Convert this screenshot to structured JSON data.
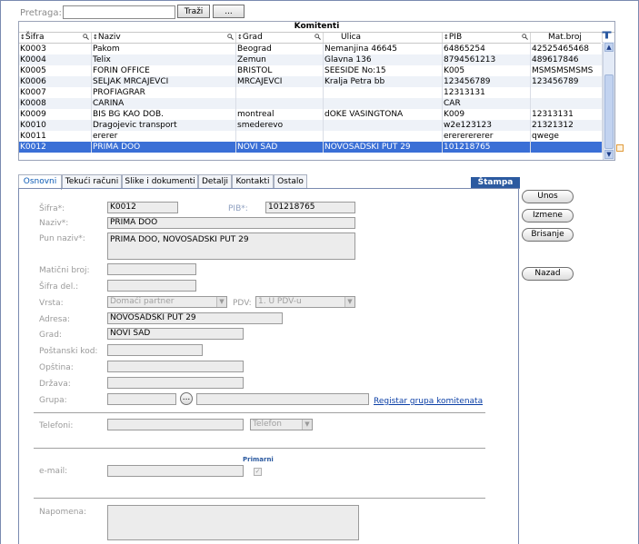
{
  "search": {
    "label": "Pretraga:",
    "value": "",
    "search_button": "Traži",
    "more_button": "..."
  },
  "grid": {
    "title": "Komitenti",
    "columns": [
      "Šifra",
      "Naziv",
      "Grad",
      "Ulica",
      "PIB",
      "Mat.broj"
    ],
    "rows": [
      [
        "K0003",
        "Pakom",
        "Beograd",
        "Nemanjina 46645",
        "64865254",
        "42525465468"
      ],
      [
        "K0004",
        "Telix",
        "Zemun",
        "Glavna 136",
        "8794561213",
        "489617846"
      ],
      [
        "K0005",
        "FORIN OFFICE",
        "BRISTOL",
        "SEESIDE No:15",
        "K005",
        "MSMSMSMSMS"
      ],
      [
        "K0006",
        "SELJAK MRCAJEVCI",
        "MRCAJEVCI",
        "Kralja Petra bb",
        "123456789",
        "123456789"
      ],
      [
        "K0007",
        "PROFIAGRAR",
        "",
        "",
        "12313131",
        ""
      ],
      [
        "K0008",
        "CARINA",
        "",
        "",
        "CAR",
        ""
      ],
      [
        "K0009",
        "BIS BG KAO DOB.",
        "montreal",
        "dOKE VASINGTONA",
        "K009",
        "12313131"
      ],
      [
        "K0010",
        "Dragojevic transport",
        "smederevo",
        "",
        "w2e123123",
        "21321312"
      ],
      [
        "K0011",
        "ererer",
        "",
        "",
        "erererererer",
        "qwege"
      ],
      [
        "K0012",
        "PRIMA DOO",
        "NOVI SAD",
        "NOVOSADSKI PUT 29",
        "101218765",
        ""
      ]
    ],
    "selected_row": 9
  },
  "tabs": [
    "Osnovni",
    "Tekući računi",
    "Slike i dokumenti",
    "Detalji",
    "Kontakti",
    "Ostalo"
  ],
  "stampa": "Štampa",
  "form": {
    "sifra_label": "Šifra*:",
    "sifra_value": "K0012",
    "pib_label": "PIB*:",
    "pib_value": "101218765",
    "naziv_label": "Naziv*:",
    "naziv_value": "PRIMA DOO",
    "pun_naziv_label": "Pun naziv*:",
    "pun_naziv_value": "PRIMA DOO, NOVOSADSKI PUT 29",
    "maticni_label": "Matični broj:",
    "maticni_value": "",
    "sifra_del_label": "Šifra del.:",
    "sifra_del_value": "",
    "vrsta_label": "Vrsta:",
    "vrsta_value": "Domaći partner",
    "pdv_label": "PDV:",
    "pdv_value": "1. U PDV-u",
    "adresa_label": "Adresa:",
    "adresa_value": "NOVOSADSKI PUT 29",
    "grad_label": "Grad:",
    "grad_value": "NOVI SAD",
    "postanski_label": "Poštanski kod:",
    "postanski_value": "",
    "opstina_label": "Opština:",
    "opstina_value": "",
    "drzava_label": "Država:",
    "drzava_value": "",
    "grupa_label": "Grupa:",
    "grupa_value": "",
    "grupa_naziv": "",
    "grupa_button": "...",
    "registar_link": "Registar grupa komitenata",
    "telefoni_label": "Telefoni:",
    "telefoni_value": "",
    "telefon_type": "Telefon",
    "primarni_label": "Primarni",
    "email_label": "e-mail:",
    "email_value": "",
    "napomena_label": "Napomena:",
    "napomena_value": ""
  },
  "actions": {
    "unos": "Unos",
    "izmene": "Izmene",
    "brisanje": "Brisanje",
    "nazad": "Nazad"
  },
  "colors": {
    "selection": "#3a6fd6",
    "accent": "#2c5aa0",
    "link": "#0b3fa6"
  }
}
